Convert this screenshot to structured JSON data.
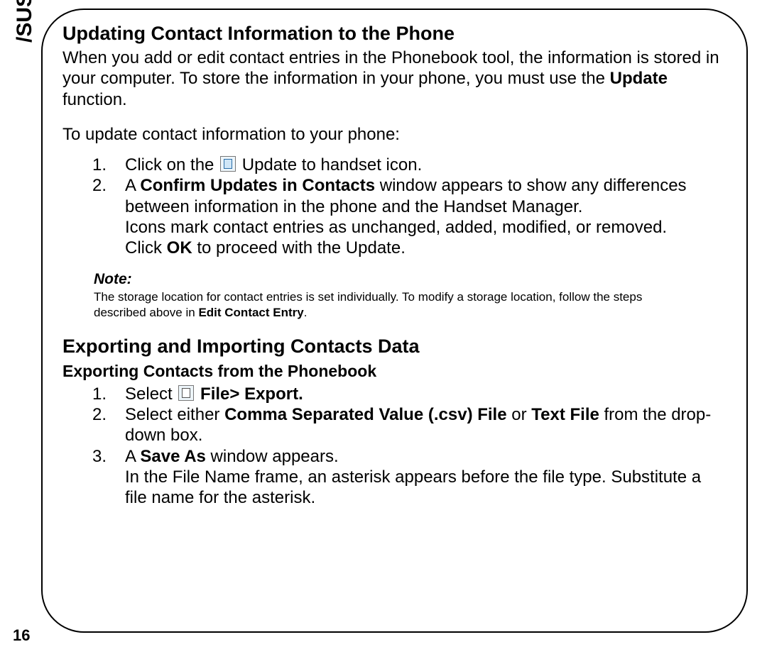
{
  "logo": {
    "text": "/SUS",
    "registered": "®"
  },
  "page_number": "16",
  "section1": {
    "heading": "Updating Contact Information to the Phone",
    "intro_pre": "When you add or edit contact entries in the Phonebook tool, the information is stored in your computer. To store the information in your phone, you must use the ",
    "intro_bold": "Update",
    "intro_post": " function.",
    "lead": "To update contact information to your phone:",
    "items": [
      {
        "num": "1.",
        "pre": "Click on the ",
        "icon": "handset-icon",
        "post": " Update to handset icon."
      },
      {
        "num": "2.",
        "l1_pre": "A ",
        "l1_bold": "Confirm Updates in Contacts",
        "l1_post": " window appears to show any differences between information in the phone and the Handset Manager.",
        "l2": "Icons mark contact entries as unchanged, added, modified, or removed.",
        "l3_pre": "Click ",
        "l3_bold": "OK",
        "l3_post": " to proceed with the Update."
      }
    ],
    "note": {
      "label": "Note:",
      "text_pre": "The storage location for contact entries is set individually. To modify a storage location, follow the steps described above in ",
      "text_bold": "Edit Contact Entry",
      "text_post": "."
    }
  },
  "section2": {
    "heading": "Exporting and Importing Contacts Data",
    "subheading": "Exporting Contacts from the Phonebook",
    "items": [
      {
        "num": "1.",
        "pre": "Select ",
        "icon": "file-icon",
        "bold": " File> Export.",
        "post": ""
      },
      {
        "num": "2.",
        "pre": "Select either ",
        "bold1": "Comma Separated Value (.csv) File",
        "mid": " or ",
        "bold2": "Text File",
        "post": " from the drop-down box."
      },
      {
        "num": "3.",
        "l1_pre": "A ",
        "l1_bold": "Save As",
        "l1_post": " window appears.",
        "l2": "In the File Name frame, an asterisk appears before the file type. Substitute a file name for the asterisk."
      }
    ]
  }
}
